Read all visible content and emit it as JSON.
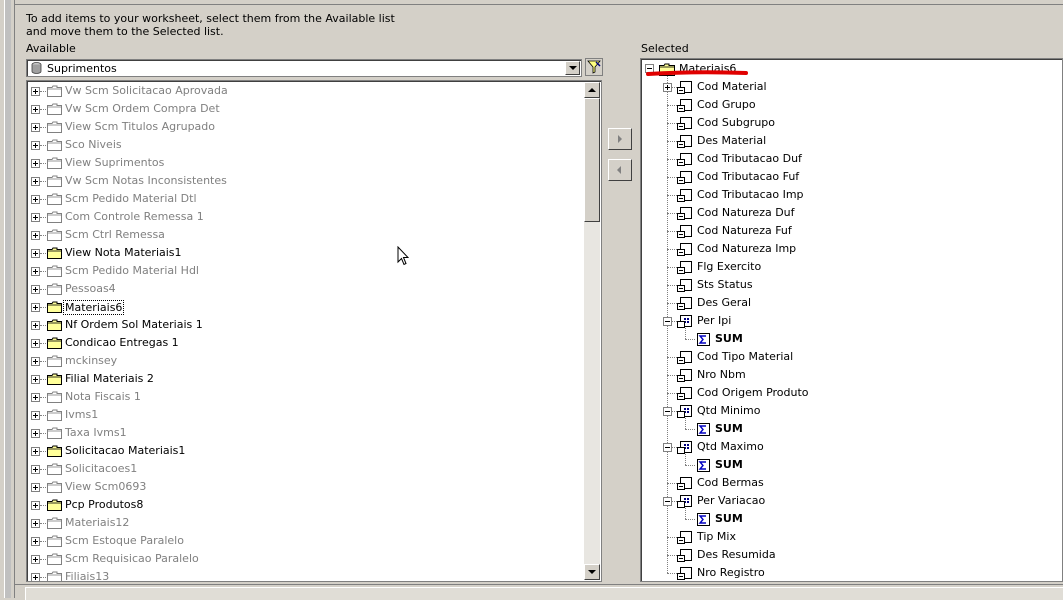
{
  "instructions": "To add items to your worksheet, select them from the Available list and move them to the Selected list.",
  "available": {
    "label": "Available",
    "source_selected": "Suprimentos",
    "items": [
      {
        "label": "Vw Scm Solicitacao Aprovada",
        "active": false
      },
      {
        "label": "Vw Scm Ordem Compra Det",
        "active": false
      },
      {
        "label": "View Scm Titulos Agrupado",
        "active": false
      },
      {
        "label": "Sco Niveis",
        "active": false
      },
      {
        "label": "View Suprimentos",
        "active": false
      },
      {
        "label": "Vw Scm Notas Inconsistentes",
        "active": false
      },
      {
        "label": "Scm Pedido Material Dtl",
        "active": false
      },
      {
        "label": "Com Controle Remessa 1",
        "active": false
      },
      {
        "label": "Scm Ctrl Remessa",
        "active": false
      },
      {
        "label": "View Nota Materiais1",
        "active": true
      },
      {
        "label": "Scm Pedido Material Hdl",
        "active": false
      },
      {
        "label": "Pessoas4",
        "active": false
      },
      {
        "label": "Materiais6",
        "active": true,
        "focused": true
      },
      {
        "label": "Nf Ordem Sol Materiais 1",
        "active": true
      },
      {
        "label": "Condicao Entregas 1",
        "active": true
      },
      {
        "label": "mckinsey",
        "active": false
      },
      {
        "label": "Filial Materiais 2",
        "active": true
      },
      {
        "label": "Nota Fiscais 1",
        "active": false
      },
      {
        "label": "Ivms1",
        "active": false
      },
      {
        "label": "Taxa Ivms1",
        "active": false
      },
      {
        "label": "Solicitacao Materiais1",
        "active": true
      },
      {
        "label": "Solicitacoes1",
        "active": false
      },
      {
        "label": "View Scm0693",
        "active": false
      },
      {
        "label": "Pcp Produtos8",
        "active": true
      },
      {
        "label": "Materiais12",
        "active": false
      },
      {
        "label": "Scm Estoque Paralelo",
        "active": false
      },
      {
        "label": "Scm Requisicao Paralelo",
        "active": false
      },
      {
        "label": "Filiais13",
        "active": false
      }
    ]
  },
  "selected": {
    "label": "Selected",
    "root": "Materiais6",
    "items": [
      {
        "label": "Cod Material",
        "kind": "item",
        "expandable": true
      },
      {
        "label": "Cod Grupo",
        "kind": "item"
      },
      {
        "label": "Cod Subgrupo",
        "kind": "item"
      },
      {
        "label": "Des Material",
        "kind": "item"
      },
      {
        "label": "Cod Tributacao Duf",
        "kind": "item"
      },
      {
        "label": "Cod Tributacao Fuf",
        "kind": "item"
      },
      {
        "label": "Cod Tributacao Imp",
        "kind": "item"
      },
      {
        "label": "Cod Natureza Duf",
        "kind": "item"
      },
      {
        "label": "Cod Natureza Fuf",
        "kind": "item"
      },
      {
        "label": "Cod Natureza Imp",
        "kind": "item"
      },
      {
        "label": "Flg Exercito",
        "kind": "item"
      },
      {
        "label": "Sts Status",
        "kind": "item"
      },
      {
        "label": "Des Geral",
        "kind": "item"
      },
      {
        "label": "Per Ipi",
        "kind": "measure",
        "expanded": true
      },
      {
        "label": "SUM",
        "kind": "agg"
      },
      {
        "label": "Cod Tipo Material",
        "kind": "item"
      },
      {
        "label": "Nro Nbm",
        "kind": "item"
      },
      {
        "label": "Cod Origem Produto",
        "kind": "item"
      },
      {
        "label": "Qtd Minimo",
        "kind": "measure",
        "expanded": true
      },
      {
        "label": "SUM",
        "kind": "agg"
      },
      {
        "label": "Qtd Maximo",
        "kind": "measure",
        "expanded": true
      },
      {
        "label": "SUM",
        "kind": "agg"
      },
      {
        "label": "Cod Bermas",
        "kind": "item"
      },
      {
        "label": "Per Variacao",
        "kind": "measure",
        "expanded": true
      },
      {
        "label": "SUM",
        "kind": "agg"
      },
      {
        "label": "Tip Mix",
        "kind": "item"
      },
      {
        "label": "Des Resumida",
        "kind": "item"
      },
      {
        "label": "Nro Registro",
        "kind": "item"
      }
    ]
  },
  "colors": {
    "annotation_underline": "#e00000",
    "disabled_text": "#808080",
    "folder_yellow": "#ffff99"
  }
}
